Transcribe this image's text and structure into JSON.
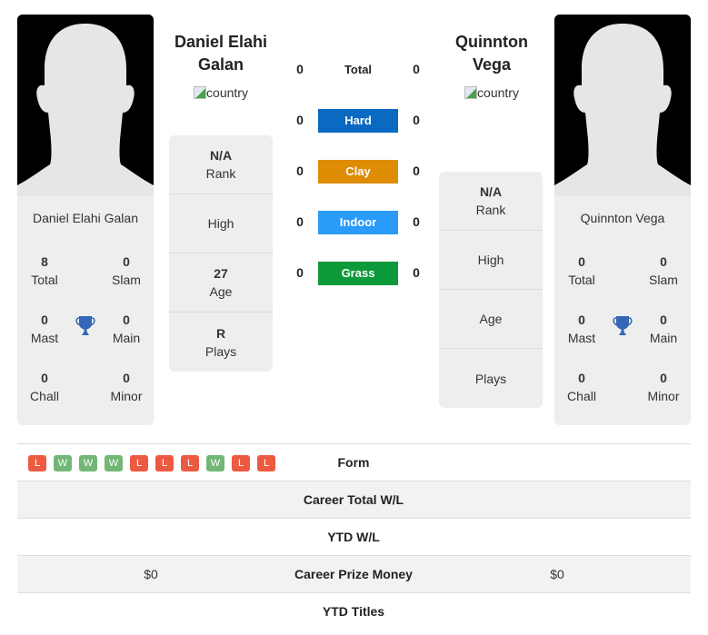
{
  "colors": {
    "hard": "#0a6ac1",
    "clay": "#de8c04",
    "indoor": "#2a9bf9",
    "grass": "#0d9a3a",
    "win": "#73b776",
    "loss": "#ec5a42",
    "trophy": "#3467b5"
  },
  "player1": {
    "name": "Daniel Elahi Galan",
    "header_name": "Daniel Elahi Galan",
    "country_alt": "country",
    "photo_icon": "silhouette-avatar",
    "titles": {
      "total": {
        "value": "8",
        "label": "Total"
      },
      "slam": {
        "value": "0",
        "label": "Slam"
      },
      "mast": {
        "value": "0",
        "label": "Mast"
      },
      "main": {
        "value": "0",
        "label": "Main"
      },
      "chall": {
        "value": "0",
        "label": "Chall"
      },
      "minor": {
        "value": "0",
        "label": "Minor"
      }
    },
    "info": {
      "rank": {
        "value": "N/A",
        "label": "Rank"
      },
      "high": {
        "value": "",
        "label": "High"
      },
      "age": {
        "value": "27",
        "label": "Age"
      },
      "plays": {
        "value": "R",
        "label": "Plays"
      }
    }
  },
  "player2": {
    "name": "Quinnton Vega",
    "header_name": "Quinnton Vega",
    "country_alt": "country",
    "photo_icon": "silhouette-avatar",
    "titles": {
      "total": {
        "value": "0",
        "label": "Total"
      },
      "slam": {
        "value": "0",
        "label": "Slam"
      },
      "mast": {
        "value": "0",
        "label": "Mast"
      },
      "main": {
        "value": "0",
        "label": "Main"
      },
      "chall": {
        "value": "0",
        "label": "Chall"
      },
      "minor": {
        "value": "0",
        "label": "Minor"
      }
    },
    "info": {
      "rank": {
        "value": "N/A",
        "label": "Rank"
      },
      "high": {
        "value": "",
        "label": "High"
      },
      "age": {
        "value": "",
        "label": "Age"
      },
      "plays": {
        "value": "",
        "label": "Plays"
      }
    }
  },
  "h2h": {
    "total": {
      "label": "Total",
      "p1": "0",
      "p2": "0"
    },
    "hard": {
      "label": "Hard",
      "p1": "0",
      "p2": "0"
    },
    "clay": {
      "label": "Clay",
      "p1": "0",
      "p2": "0"
    },
    "indoor": {
      "label": "Indoor",
      "p1": "0",
      "p2": "0"
    },
    "grass": {
      "label": "Grass",
      "p1": "0",
      "p2": "0"
    }
  },
  "table": {
    "form": {
      "label": "Form",
      "p1": [
        "L",
        "W",
        "W",
        "W",
        "L",
        "L",
        "L",
        "W",
        "L",
        "L"
      ]
    },
    "career_wl": {
      "label": "Career Total W/L",
      "p1": "",
      "p2": ""
    },
    "ytd_wl": {
      "label": "YTD W/L",
      "p1": "",
      "p2": ""
    },
    "prize": {
      "label": "Career Prize Money",
      "p1": "$0",
      "p2": "$0"
    },
    "ytd_titles": {
      "label": "YTD Titles",
      "p1": "",
      "p2": ""
    }
  }
}
